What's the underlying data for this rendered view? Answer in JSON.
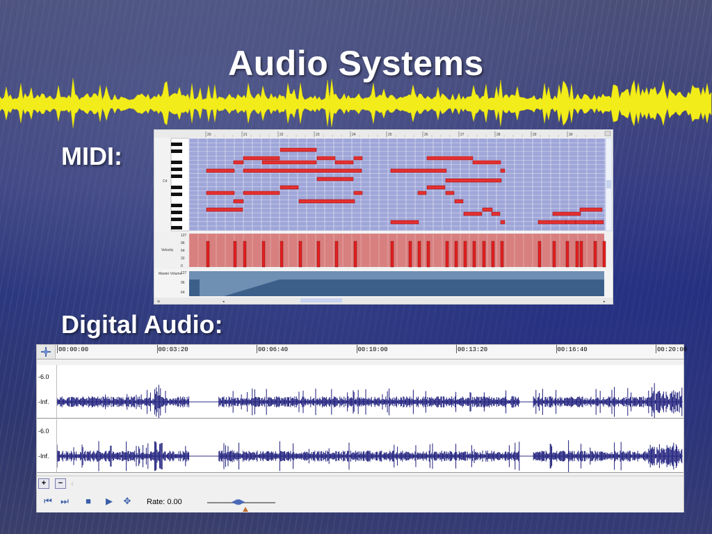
{
  "slide": {
    "title": "Audio Systems",
    "midi_label": "MIDI:",
    "digital_audio_label": "Digital Audio:"
  },
  "midi_editor": {
    "ruler_marks": [
      "20",
      "21",
      "22",
      "23",
      "24",
      "25",
      "26",
      "27",
      "28",
      "29",
      "30"
    ],
    "key_label": "C4",
    "velocity_label": "Velocity",
    "velocity_ticks": [
      "127",
      "96",
      "64",
      "32",
      "0"
    ],
    "mute_label": "Master Volume",
    "mute_ticks": [
      "127",
      "96",
      "64"
    ]
  },
  "audio_editor": {
    "time_marks": [
      "00:00:00",
      "00:03:20",
      "00:06:40",
      "00:10:00",
      "00:13:20",
      "00:16:40",
      "00:20:00"
    ],
    "channels": [
      {
        "db_top": "-6.0",
        "db_mid": "-Inf."
      },
      {
        "db_top": "-6.0",
        "db_mid": "-Inf."
      }
    ],
    "zoom_in_label": "+",
    "zoom_out_label": "−",
    "rate_label": "Rate: 0.00",
    "colors": {
      "waveform": "#1a1a7a",
      "banner_wave": "#f2ec1a"
    }
  }
}
